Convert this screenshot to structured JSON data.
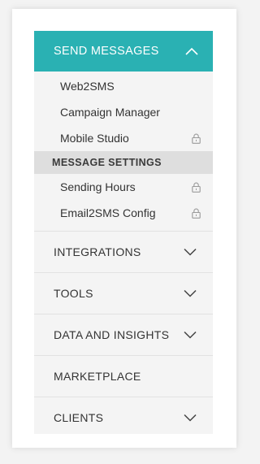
{
  "sidebar": {
    "send_messages": {
      "label": "SEND MESSAGES",
      "expanded": true,
      "icon": "chevron-up-icon",
      "accent_color": "#2ab1b3"
    },
    "sub_items": [
      {
        "label": "Web2SMS",
        "locked": false
      },
      {
        "label": "Campaign Manager",
        "locked": false
      },
      {
        "label": "Mobile Studio",
        "locked": true
      }
    ],
    "message_settings": {
      "heading": "MESSAGE SETTINGS",
      "items": [
        {
          "label": "Sending Hours",
          "locked": true
        },
        {
          "label": "Email2SMS Config",
          "locked": true
        }
      ]
    },
    "main_items": [
      {
        "label": "INTEGRATIONS",
        "expandable": true
      },
      {
        "label": "TOOLS",
        "expandable": true
      },
      {
        "label": "DATA AND INSIGHTS",
        "expandable": true
      },
      {
        "label": "MARKETPLACE",
        "expandable": false
      },
      {
        "label": "CLIENTS",
        "expandable": true
      }
    ]
  }
}
